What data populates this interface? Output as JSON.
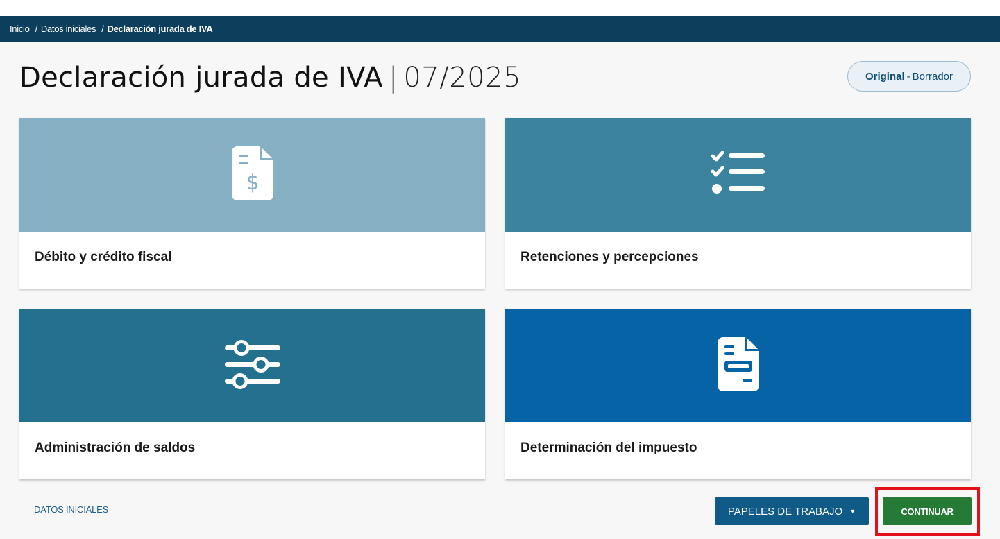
{
  "breadcrumb": {
    "items": [
      "Inicio",
      "Datos iniciales",
      "Declaración jurada de IVA"
    ],
    "separator": "/"
  },
  "header": {
    "title": "Declaración jurada de IVA",
    "divider": "|",
    "period": "07/2025",
    "status": {
      "type": "Original",
      "dash": "-",
      "state": "Borrador"
    }
  },
  "cards": [
    {
      "label": "Débito y crédito fiscal",
      "icon": "invoice-dollar-icon",
      "color": "#86b0c4"
    },
    {
      "label": "Retenciones y percepciones",
      "icon": "checklist-icon",
      "color": "#3b839f"
    },
    {
      "label": "Administración de saldos",
      "icon": "sliders-icon",
      "color": "#24708f"
    },
    {
      "label": "Determinación del impuesto",
      "icon": "document-form-icon",
      "color": "#0563a6"
    }
  ],
  "footer": {
    "link": "DATOS INICIALES",
    "papers_button": "PAPELES DE TRABAJO",
    "continue_button": "CONTINUAR"
  },
  "colors": {
    "breadcrumb_bg": "#0d3e5c",
    "primary_button": "#0f5a87",
    "continue_button": "#257a36",
    "highlight": "#e3101a"
  }
}
